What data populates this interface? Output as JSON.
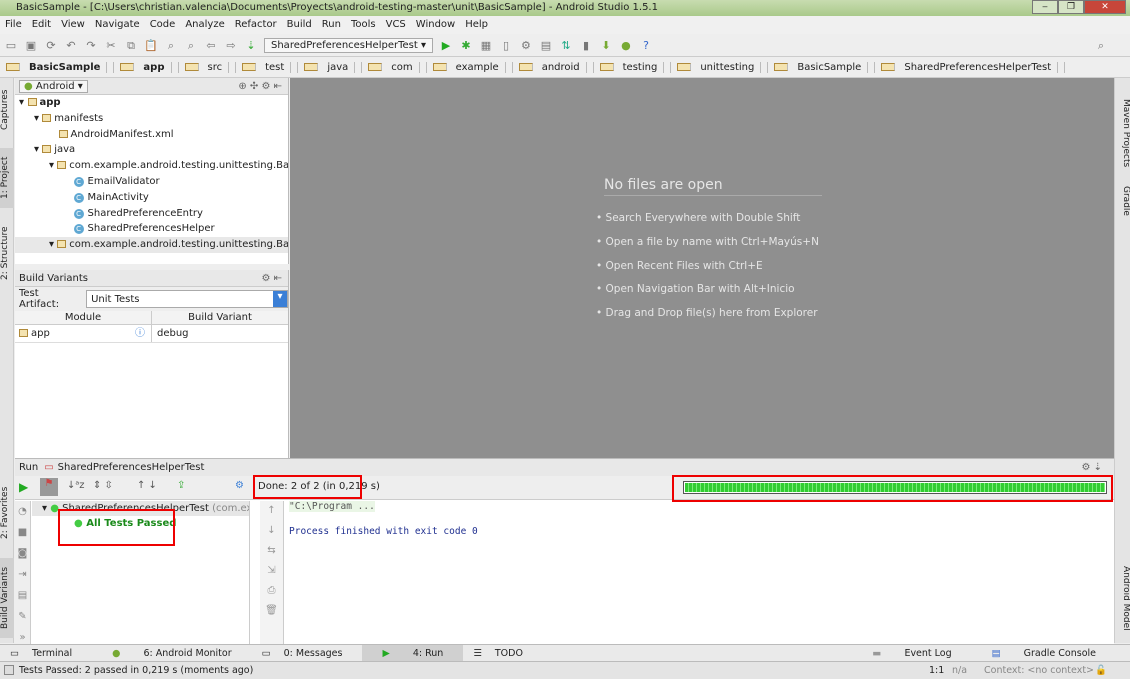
{
  "window": {
    "title": "BasicSample - [C:\\Users\\christian.valencia\\Documents\\Proyects\\android-testing-master\\unit\\BasicSample] - Android Studio 1.5.1",
    "min": "‒",
    "max": "❐",
    "close": "✕"
  },
  "menu": [
    "File",
    "Edit",
    "View",
    "Navigate",
    "Code",
    "Analyze",
    "Refactor",
    "Build",
    "Run",
    "Tools",
    "VCS",
    "Window",
    "Help"
  ],
  "toolbar": {
    "run_config": "SharedPreferencesHelperTest",
    "help": "?"
  },
  "breadcrumbs": [
    "BasicSample",
    "app",
    "src",
    "test",
    "java",
    "com",
    "example",
    "android",
    "testing",
    "unittesting",
    "BasicSample",
    "SharedPreferencesHelperTest"
  ],
  "left_stripe": [
    "1: Project",
    "2: Structure",
    "Captures",
    "2: Favorites",
    "Build Variants"
  ],
  "right_stripe": [
    "Maven Projects",
    "Gradle",
    "Android Model"
  ],
  "project": {
    "view": "Android",
    "tree": [
      {
        "label": "app",
        "depth": 0,
        "kind": "module"
      },
      {
        "label": "manifests",
        "depth": 1,
        "kind": "folder"
      },
      {
        "label": "AndroidManifest.xml",
        "depth": 2,
        "kind": "xml"
      },
      {
        "label": "java",
        "depth": 1,
        "kind": "folder"
      },
      {
        "label": "com.example.android.testing.unittesting.BasicSa",
        "depth": 2,
        "kind": "package"
      },
      {
        "label": "EmailValidator",
        "depth": 3,
        "kind": "class"
      },
      {
        "label": "MainActivity",
        "depth": 3,
        "kind": "class"
      },
      {
        "label": "SharedPreferenceEntry",
        "depth": 3,
        "kind": "class"
      },
      {
        "label": "SharedPreferencesHelper",
        "depth": 3,
        "kind": "class"
      },
      {
        "label": "com.example.android.testing.unittesting.BasicSa",
        "depth": 2,
        "kind": "package"
      }
    ]
  },
  "build_variants": {
    "title": "Build Variants",
    "artifact_label": "Test Artifact:",
    "artifact_value": "Unit Tests",
    "col_module": "Module",
    "col_variant": "Build Variant",
    "rows": [
      {
        "module": "app",
        "variant": "debug"
      }
    ]
  },
  "editor": {
    "empty_title": "No files are open",
    "hints": [
      "• Search Everywhere with Double Shift",
      "• Open a file by name with Ctrl+Mayús+N",
      "• Open Recent Files with Ctrl+E",
      "• Open Navigation Bar with Alt+Inicio",
      "• Drag and Drop file(s) here from Explorer"
    ]
  },
  "run": {
    "label": "Run",
    "config": "SharedPreferencesHelperTest",
    "done": "Done: 2 of 2 (in 0,219 s)",
    "progress": 1.0,
    "root": "SharedPreferencesHelperTest",
    "root_pkg": "(com.exampl",
    "passed": "All Tests Passed",
    "console": [
      "\"C:\\Program ...",
      "",
      "Process finished with exit code 0"
    ]
  },
  "bottom_tabs": [
    "Terminal",
    "6: Android Monitor",
    "0: Messages",
    "4: Run",
    "TODO",
    "Event Log",
    "Gradle Console"
  ],
  "status": {
    "message": "Tests Passed: 2 passed in 0,219 s (moments ago)",
    "position": "1:1",
    "encoding": "n/a",
    "context": "Context: <no context>"
  }
}
